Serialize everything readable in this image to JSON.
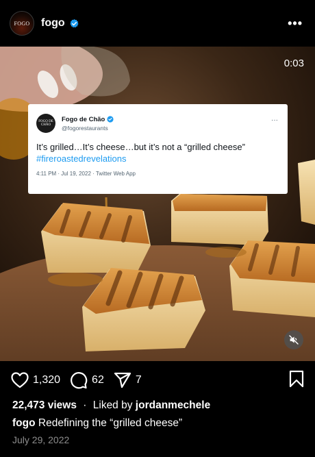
{
  "header": {
    "avatar_text": "FOGO",
    "username": "fogo",
    "more_label": "•••"
  },
  "video": {
    "timer": "0:03"
  },
  "tweet": {
    "avatar_text": "FOGO DE CHÃO",
    "name": "Fogo de Chão",
    "handle": "@fogorestaurants",
    "text": "It’s grilled…It’s cheese…but it’s not a “grilled cheese”",
    "hashtag": "#fireroastedrevelations",
    "meta": "4:11 PM · Jul 19, 2022 · Twitter Web App",
    "more_label": "···"
  },
  "actions": {
    "likes": "1,320",
    "comments": "62",
    "shares": "7"
  },
  "post": {
    "views": "22,473 views",
    "separator": "·",
    "liked_by_prefix": "Liked by",
    "liked_by_user": "jordanmechele",
    "caption_user": "fogo",
    "caption_text": "Redefining the “grilled cheese”",
    "date": "July 29, 2022"
  },
  "colors": {
    "background": "#000000",
    "verified": "#1d9bf0",
    "hashtag": "#1d9bf0",
    "muted_text": "#8e8e8e"
  },
  "icons": {
    "like": "heart-icon",
    "comment": "comment-icon",
    "share": "send-icon",
    "save": "bookmark-icon",
    "mute": "speaker-muted-icon",
    "verified": "verified-badge-icon"
  }
}
